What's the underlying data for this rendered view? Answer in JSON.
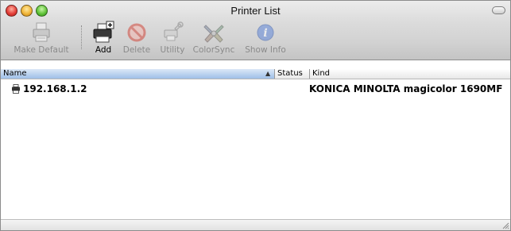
{
  "window": {
    "title": "Printer List"
  },
  "toolbar": {
    "items": [
      {
        "label": "Make Default",
        "icon": "printer-default-icon",
        "enabled": false
      },
      {
        "label": "Add",
        "icon": "add-printer-icon",
        "enabled": true
      },
      {
        "label": "Delete",
        "icon": "delete-icon",
        "enabled": false
      },
      {
        "label": "Utility",
        "icon": "utility-icon",
        "enabled": false
      },
      {
        "label": "ColorSync",
        "icon": "colorsync-icon",
        "enabled": false
      },
      {
        "label": "Show Info",
        "icon": "info-icon",
        "enabled": false
      }
    ]
  },
  "list": {
    "columns": {
      "name": "Name",
      "status": "Status",
      "kind": "Kind"
    },
    "rows": [
      {
        "name": "192.168.1.2",
        "status": "",
        "kind": "KONICA MINOLTA magicolor 1690MF",
        "icon": "printer-icon"
      }
    ]
  },
  "colors": {
    "header_selected": "#9ebfe8",
    "close": "#e3403a",
    "minimize": "#f0b63a",
    "zoom": "#62c43a"
  }
}
